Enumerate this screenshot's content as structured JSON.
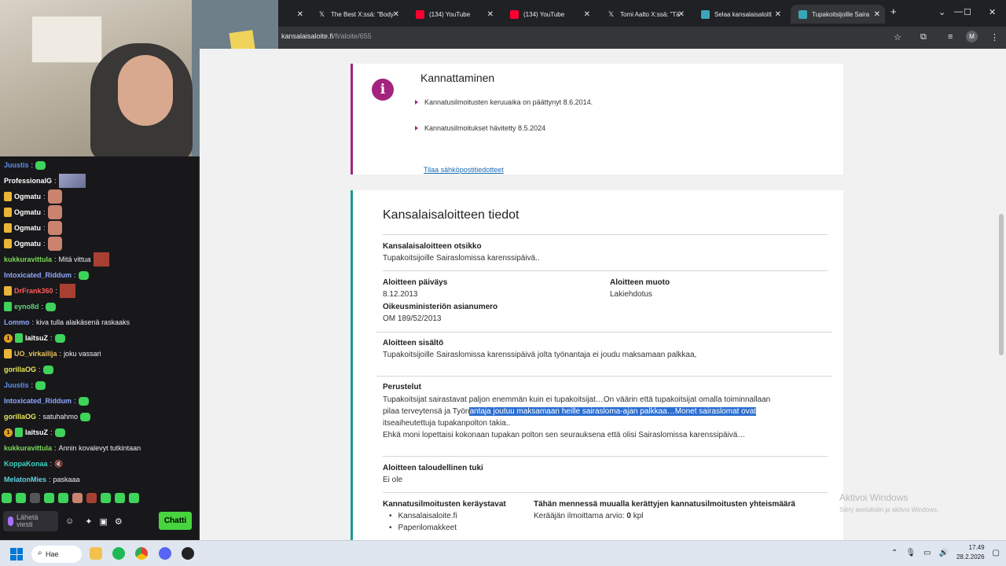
{
  "browser": {
    "tabs": [
      {
        "title": "",
        "icon": "x-icon"
      },
      {
        "title": "The Best X:ssä: \"Body",
        "icon": "x-icon"
      },
      {
        "title": "(134) YouTube",
        "icon": "youtube-icon"
      },
      {
        "title": "(134) YouTube",
        "icon": "youtube-icon"
      },
      {
        "title": "Tomi Aalto X:ssä: \"Tä",
        "icon": "x-icon"
      },
      {
        "title": "Selaa kansalaisaloitt",
        "icon": "site-icon"
      },
      {
        "title": "Tupakoitsijoille Saira",
        "icon": "site-icon",
        "active": true
      }
    ],
    "url_domain": "kansalaisaloite.fi",
    "url_path": "/fi/aloite/655"
  },
  "kannattaminen": {
    "title": "Kannattaminen",
    "items": [
      "Kannatusilmoitusten keruuaika on päättynyt 8.6.2014.",
      "Kannatusilmoitukset hävitetty 8.5.2024"
    ],
    "link": "Tilaa sähköpostitiedotteet"
  },
  "tiedot": {
    "title": "Kansalaisaloitteen tiedot",
    "otsikko_label": "Kansalaisaloitteen otsikko",
    "otsikko_value": "Tupakoitsijoille Sairaslomissa karenssipäivä..",
    "paivays_label": "Aloitteen päiväys",
    "paivays_value": "8.12.2013",
    "muoto_label": "Aloitteen muoto",
    "muoto_value": "Lakiehdotus",
    "asianumero_label": "Oikeusministeriön asianumero",
    "asianumero_value": "OM 189/52/2013",
    "sisalto_label": "Aloitteen sisältö",
    "sisalto_value": "Tupakoitsijoille Sairaslomissa karenssipäivä jolta työnantaja ei joudu maksamaan palkkaa,",
    "perustelut_label": "Perustelut",
    "perustelut_line1": "Tupakoitsijat sairastavat paljon enemmän kuin ei tupakoitsijat…On väärin että tupakoitsijat omalla toiminnallaan",
    "perustelut_line2_a": "pilaa terveytensä ja Työn",
    "perustelut_line2_b": "antaja joutuu maksamaan heille sairasloma-ajan palkkaa…Monet sairaslomat ovat",
    "perustelut_line3": "itseaiheutettuja tupakanpolton takia..",
    "perustelut_line4": "Ehkä moni lopettaisi kokonaan tupakan polton sen seurauksena että olisi Sairaslomissa karenssipäivä…",
    "tuki_label": "Aloitteen taloudellinen tuki",
    "tuki_value": "Ei ole",
    "keraystavat_label": "Kannatusilmoitusten keräystavat",
    "keraystavat": [
      "Kansalaisaloite.fi",
      "Paperilomakkeet"
    ],
    "muualla_label": "Tähän mennessä muualla kerättyjen kannatusilmoitusten yhteismäärä",
    "muualla_prefix": "Kerääjän ilmoittama arvio:",
    "muualla_count": "0",
    "muualla_unit": "kpl"
  },
  "watermark": {
    "title": "Aktivoi Windows",
    "subtitle": "Siirry asetuksiin ja aktivoi Windows."
  },
  "chat": {
    "messages": [
      {
        "user": "Juustis",
        "text": "",
        "color": "#5c8ff2"
      },
      {
        "user": "ProfessionalG",
        "text": "",
        "color": "#ffffff"
      },
      {
        "user": "Ogmatu",
        "text": "",
        "color": "#ffffff"
      },
      {
        "user": "Ogmatu",
        "text": "",
        "color": "#ffffff"
      },
      {
        "user": "Ogmatu",
        "text": "",
        "color": "#ffffff"
      },
      {
        "user": "Ogmatu",
        "text": "",
        "color": "#ffffff"
      },
      {
        "user": "kukkuravittula",
        "text": "Mitä vittua",
        "color": "#7cd957"
      },
      {
        "user": "Intoxicated_Riddum",
        "text": "",
        "color": "#8fa8ff"
      },
      {
        "user": "DrFrank360",
        "text": "",
        "color": "#ff5a5a"
      },
      {
        "user": "eyno8d",
        "text": "",
        "color": "#5fd37a"
      },
      {
        "user": "Lommo",
        "text": "kiva tulla alaikäsenä raskaaks",
        "color": "#8fa8ff"
      },
      {
        "user": "laitsuZ",
        "text": "",
        "color": "#ffffff"
      },
      {
        "user": "UO_virkailija",
        "text": "joku vassari",
        "color": "#e8c15a"
      },
      {
        "user": "gorillaOG",
        "text": "",
        "color": "#e8e85a"
      },
      {
        "user": "Juustis",
        "text": "",
        "color": "#5c8ff2"
      },
      {
        "user": "Intoxicated_Riddum",
        "text": "",
        "color": "#8fa8ff"
      },
      {
        "user": "gorillaOG",
        "text": "satuhahmo",
        "color": "#e8e85a"
      },
      {
        "user": "laitsuZ",
        "text": "",
        "color": "#ffffff"
      },
      {
        "user": "kukkuravittula",
        "text": "Annin kovalevyt tutkintaan",
        "color": "#7cd957"
      },
      {
        "user": "KoppaKonaa",
        "text": "",
        "color": "#3fd3c0"
      },
      {
        "user": "MelatonMies",
        "text": "paskaaa",
        "color": "#5fd3e0"
      }
    ],
    "input_placeholder": "Lähetä viesti",
    "send_label": "Chatti"
  },
  "taskbar": {
    "search_label": "Hae",
    "time": "17.49",
    "date": "28.2.2026"
  }
}
